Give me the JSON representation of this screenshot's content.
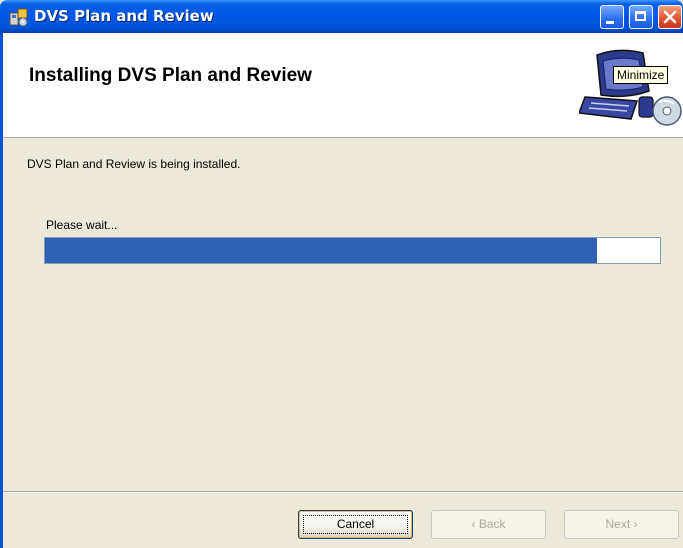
{
  "window": {
    "title": "DVS Plan and Review",
    "icon": "installer-icon"
  },
  "titlebar_buttons": {
    "minimize": "minimize-icon",
    "maximize": "maximize-icon",
    "close": "close-icon"
  },
  "tooltip": {
    "text": "Minimize"
  },
  "banner": {
    "title": "Installing DVS Plan and Review",
    "art": "computer-cd-icon"
  },
  "body": {
    "status": "DVS Plan and Review is being installed.",
    "wait_label": "Please wait...",
    "progress_fraction": 0.898
  },
  "buttons": {
    "cancel": "Cancel",
    "back": "‹ Back",
    "next": "Next ›"
  },
  "colors": {
    "titlebar": "#0058e8",
    "progress": "#2f62b4",
    "face": "#ece9d8"
  }
}
